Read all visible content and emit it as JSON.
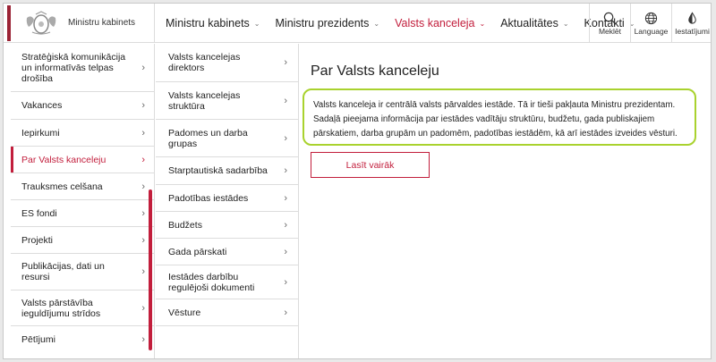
{
  "header": {
    "logo_text": "Ministru kabinets",
    "nav": [
      {
        "label": "Ministru kabinets",
        "active": false
      },
      {
        "label": "Ministru prezidents",
        "active": false
      },
      {
        "label": "Valsts kanceleja",
        "active": true
      },
      {
        "label": "Aktualitātes",
        "active": false
      },
      {
        "label": "Kontakti",
        "active": false
      }
    ],
    "tools": [
      {
        "label": "Meklēt",
        "icon": "search-icon"
      },
      {
        "label": "Language",
        "icon": "globe-icon"
      },
      {
        "label": "Iestatījumi",
        "icon": "contrast-drop-icon"
      }
    ],
    "accent_color": "#c21e3c"
  },
  "left_menu": [
    {
      "label": "Stratēģiskā komunikācija un informatīvās telpas drošība"
    },
    {
      "label": "Vakances"
    },
    {
      "label": "Iepirkumi"
    },
    {
      "label": "Par Valsts kanceleju",
      "active": true
    },
    {
      "label": "Trauksmes celšana"
    },
    {
      "label": "ES fondi"
    },
    {
      "label": "Projekti"
    },
    {
      "label": "Publikācijas, dati un resursi"
    },
    {
      "label": "Valsts pārstāvība ieguldījumu strīdos"
    },
    {
      "label": "Pētījumi"
    }
  ],
  "sub_menu": [
    {
      "label": "Valsts kancelejas direktors"
    },
    {
      "label": "Valsts kancelejas struktūra"
    },
    {
      "label": "Padomes un darba grupas"
    },
    {
      "label": "Starptautiskā sadarbība"
    },
    {
      "label": "Padotības iestādes"
    },
    {
      "label": "Budžets"
    },
    {
      "label": "Gada pārskati"
    },
    {
      "label": "Iestādes darbību regulējoši dokumenti"
    },
    {
      "label": "Vēsture"
    }
  ],
  "content": {
    "title": "Par Valsts kanceleju",
    "description": "Valsts kanceleja ir centrālā valsts pārvaldes iestāde. Tā ir tieši pakļauta Ministru prezidentam. Sadaļā pieejama informācija par iestādes vadītāju struktūru, budžetu, gada publiskajiem pārskatiem, darba grupām un padomēm, padotības iestādēm, kā arī iestādes izveides vēsturi.",
    "read_more_label": "Lasīt vairāk",
    "highlight_color": "#a9d22e"
  }
}
